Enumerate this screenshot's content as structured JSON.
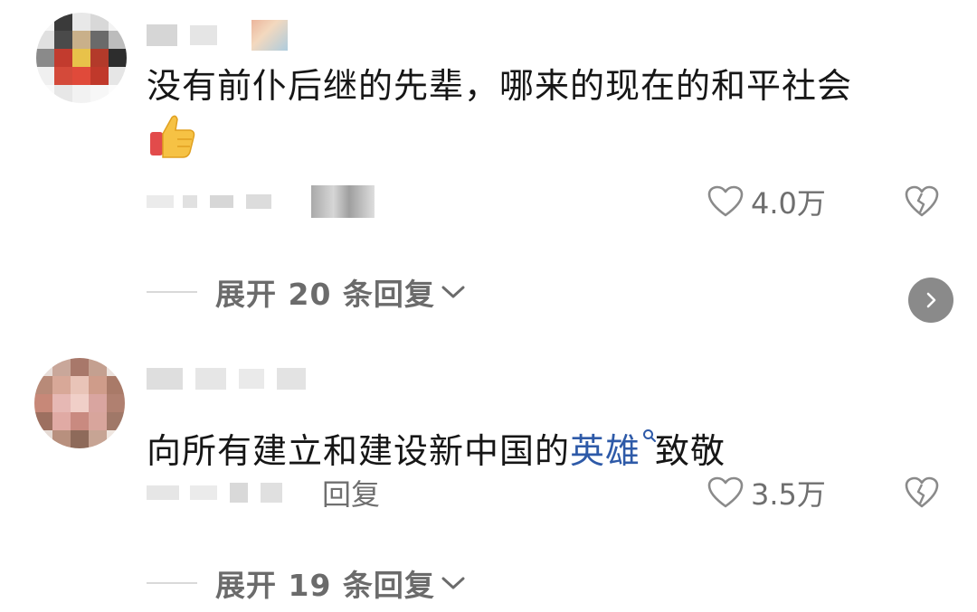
{
  "comments": [
    {
      "text": "没有前仆后继的先辈，哪来的现在的和平社会",
      "has_emoji": true,
      "emoji": "thumbs-up",
      "like_count": "4.0万",
      "expand_label": "展开 20 条回复"
    },
    {
      "text_before": "向所有建立和建设新中国的",
      "link_text": "英雄",
      "text_after": "致敬",
      "reply_label": "回复",
      "like_count": "3.5万",
      "expand_label": "展开 19 条回复"
    }
  ],
  "colors": {
    "link": "#2e5aa8",
    "muted_text": "#6f6f6f",
    "next_button_bg": "#8a8a8a"
  },
  "icons": {
    "like": "heart-outline-icon",
    "dislike": "broken-heart-icon",
    "expand": "chevron-down-icon",
    "next": "chevron-right-icon",
    "search_hint": "search-icon"
  }
}
